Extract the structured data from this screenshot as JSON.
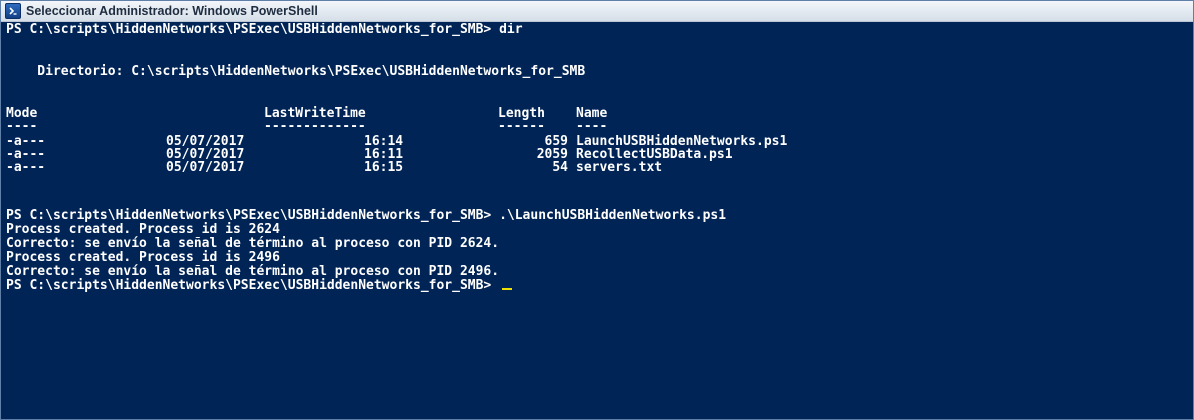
{
  "window": {
    "title": "Seleccionar Administrador: Windows PowerShell",
    "icon": "powershell-icon"
  },
  "console": {
    "prompt_dir_command": "PS C:\\scripts\\HiddenNetworks\\PSExec\\USBHiddenNetworks_for_SMB> dir",
    "directory_heading": "    Directorio: C:\\scripts\\HiddenNetworks\\PSExec\\USBHiddenNetworks_for_SMB",
    "columns": {
      "mode": "Mode",
      "mode_rule": "----",
      "lastwritetime": "LastWriteTime",
      "lastwritetime_rule": "-------------",
      "length": "Length",
      "length_rule": "------",
      "name": "Name",
      "name_rule": "----"
    },
    "files": [
      {
        "mode": "-a---",
        "date": "05/07/2017",
        "time": "16:14",
        "length": "659",
        "name": "LaunchUSBHiddenNetworks.ps1"
      },
      {
        "mode": "-a---",
        "date": "05/07/2017",
        "time": "16:11",
        "length": "2059",
        "name": "RecollectUSBData.ps1"
      },
      {
        "mode": "-a---",
        "date": "05/07/2017",
        "time": "16:15",
        "length": "54",
        "name": "servers.txt"
      }
    ],
    "output_lines": [
      "PS C:\\scripts\\HiddenNetworks\\PSExec\\USBHiddenNetworks_for_SMB> .\\LaunchUSBHiddenNetworks.ps1",
      "Process created. Process id is 2624",
      "Correcto: se envío la señal de término al proceso con PID 2624.",
      "Process created. Process id is 2496",
      "Correcto: se envío la señal de término al proceso con PID 2496."
    ],
    "final_prompt": "PS C:\\scripts\\HiddenNetworks\\PSExec\\USBHiddenNetworks_for_SMB> ",
    "colors": {
      "background": "#012456",
      "text": "#ffffff",
      "cursor": "#f0e000"
    }
  }
}
